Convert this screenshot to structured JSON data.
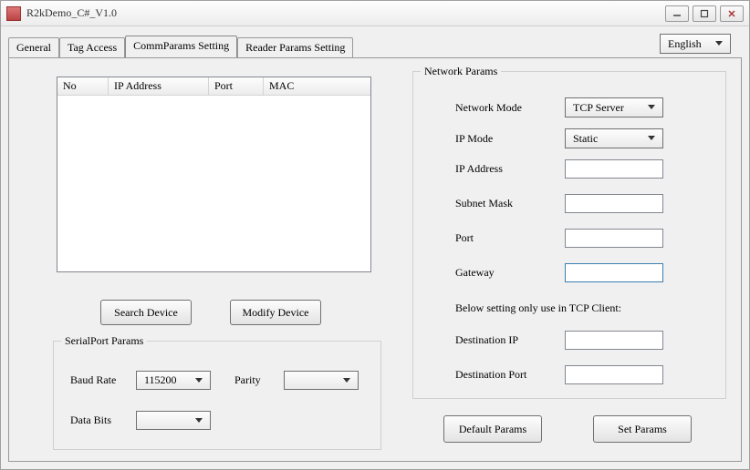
{
  "window": {
    "title": "R2kDemo_C#_V1.0"
  },
  "language": {
    "selected": "English"
  },
  "tabs": {
    "general": "General",
    "tag_access": "Tag Access",
    "comm_params": "CommParams Setting",
    "reader_params": "Reader Params Setting"
  },
  "device_table": {
    "col_no": "No",
    "col_ip": "IP Address",
    "col_port": "Port",
    "col_mac": "MAC"
  },
  "buttons": {
    "search_device": "Search Device",
    "modify_device": "Modify Device",
    "default_params": "Default Params",
    "set_params": "Set Params"
  },
  "serial": {
    "legend": "SerialPort Params",
    "baud_label": "Baud Rate",
    "baud_value": "115200",
    "parity_label": "Parity",
    "parity_value": "",
    "databits_label": "Data Bits",
    "databits_value": ""
  },
  "network": {
    "legend": "Network Params",
    "mode_label": "Network Mode",
    "mode_value": "TCP Server",
    "ipmode_label": "IP Mode",
    "ipmode_value": "Static",
    "ip_label": "IP Address",
    "ip_value": "",
    "subnet_label": "Subnet Mask",
    "subnet_value": "",
    "port_label": "Port",
    "port_value": "",
    "gateway_label": "Gateway",
    "gateway_value": "",
    "note": "Below setting only use in TCP Client:",
    "destip_label": "Destination IP",
    "destip_value": "",
    "destport_label": "Destination Port",
    "destport_value": ""
  }
}
